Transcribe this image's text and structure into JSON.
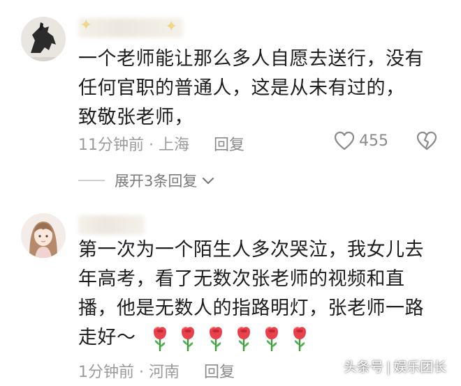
{
  "comments": [
    {
      "lines": [
        "一个老师能让那么多人自愿去送行，没有",
        "任何官职的普通人，这是从未有过的，",
        "致敬张老师，"
      ],
      "time_location": "11分钟前 · 上海",
      "reply_label": "回复",
      "like_count": "455",
      "expand_label": "展开3条回复"
    },
    {
      "lines": [
        "第一次为一个陌生人多次哭泣，我女儿去",
        "年高考，看了无数次张老师的视频和直",
        "播，他是无数人的指路明灯，张老师一路",
        "走好～"
      ],
      "rose_count": 6,
      "time_location": "1分钟前 · 河南",
      "reply_label": "回复"
    }
  ],
  "watermark": {
    "platform": "头条号",
    "account": "娱乐团长"
  },
  "icons": {
    "like": "heart-outline-icon",
    "dislike": "broken-heart-icon",
    "expand": "chevron-down-icon",
    "emoji": "rose-emoji"
  },
  "colors": {
    "text": "#1d1d1d",
    "meta": "#9a9a9a",
    "rose": "#e8414b"
  }
}
